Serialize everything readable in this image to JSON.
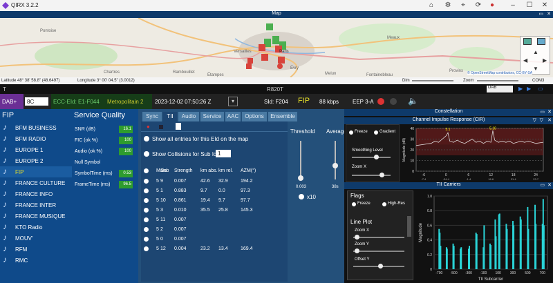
{
  "app": {
    "title": "QIRX 3.2.2"
  },
  "map": {
    "title": "Map",
    "latitude": "Latitude  48° 38' 58.8\" (48.6497)",
    "longitude": "Longitude 3° 00' 04.5\" (3.0012)",
    "dim": "Dim",
    "zoom": "Zoom",
    "com": "COM3",
    "attribution": "© OpenStreetMap contributors, CC-BY-SA",
    "places": [
      "Pontoise",
      "Paris",
      "Meaux",
      "Versailles",
      "Évry",
      "Melun",
      "Rambouillet",
      "Provins",
      "Chartres",
      "Étampes",
      "Fontainebleau"
    ]
  },
  "rx": {
    "left": "T",
    "center": "R820T",
    "mode": "DAB"
  },
  "info": {
    "band": "DAB+",
    "ch": "8C",
    "ecc": "ECC-EId: E1-F044",
    "ens": "Metropolitain 2",
    "datetime": "2023-12-02  07:50:26 Z",
    "sid": "SId: F204",
    "service": "FIP",
    "rate": "88 kbps",
    "eep": "EEP 3-A"
  },
  "fip": {
    "title": "FIP",
    "stations": [
      "BFM BUSINESS",
      "BFM RADIO",
      "EUROPE 1",
      "EUROPE 2",
      "FIP",
      "FRANCE CULTURE",
      "FRANCE INFO",
      "FRANCE INTER",
      "FRANCE MUSIQUE",
      "KTO Radio",
      "MOUV'",
      "RFM",
      "RMC"
    ]
  },
  "sq": {
    "title": "Service Quality",
    "rows": [
      {
        "label": "SNR (dB)",
        "value": "16.1",
        "color": "#2e9c2e"
      },
      {
        "label": "FIC (ok %)",
        "value": "100",
        "color": "#2e9c2e"
      },
      {
        "label": "Audio (ok %)",
        "value": "100",
        "color": "#2e9c2e"
      },
      {
        "label": "Null Symbol",
        "value": "",
        "color": ""
      },
      {
        "label": "SymbolTime (ms)",
        "value": "0.53",
        "color": "#2e9c2e"
      },
      {
        "label": "FrameTime (ms)",
        "value": "96.5",
        "color": "#2e9c2e"
      }
    ]
  },
  "tabs": {
    "items": [
      "Sync",
      "TII",
      "Audio",
      "Service",
      "AAC",
      "Options",
      "Ensemble"
    ],
    "active": 1
  },
  "tii": {
    "opt1": "Show all entries for this EId on the map",
    "opt2": "Show Collisions for Sub Id",
    "sub_sel": "1",
    "headers": [
      "Main",
      "Sub",
      "Strength",
      "km abs.",
      "km rel.",
      "AZM(°)"
    ],
    "rows": [
      [
        "5",
        "9",
        "0.007",
        "42.6",
        "32.9",
        "194.2"
      ],
      [
        "5",
        "1",
        "0.883",
        "9.7",
        "0.0",
        "97.3"
      ],
      [
        "5",
        "10",
        "0.861",
        "19.4",
        "9.7",
        "97.7"
      ],
      [
        "5",
        "3",
        "0.010",
        "35.5",
        "25.8",
        "145.3"
      ],
      [
        "5",
        "11",
        "0.007",
        "",
        "",
        ""
      ],
      [
        "5",
        "2",
        "0.007",
        "",
        "",
        ""
      ],
      [
        "5",
        "0",
        "0.007",
        "",
        "",
        ""
      ],
      [
        "5",
        "12",
        "0.004",
        "23.2",
        "13.4",
        "169.4"
      ]
    ],
    "threshold_label": "Threshold",
    "threshold_value": "0.003",
    "average_label": "Average",
    "average_value": "38s",
    "x10": "x10"
  },
  "constellation": {
    "title": "Constellation"
  },
  "cir": {
    "title": "Channel Impulse Response (CIR)",
    "freeze": "Freeze",
    "gradient": "Gradient",
    "smoothing": "Smoothing Level",
    "zoomx": "Zoom X",
    "xlabel": "Distance Difference (km)",
    "ylabel": "Magnitude (dB)",
    "xticks": [
      "-6",
      "0",
      "6",
      "12",
      "18",
      "24"
    ],
    "xsub": [
      "-7.4",
      "-34.4",
      "-1.4",
      "16.6",
      "31.4",
      "23.7"
    ],
    "yticks": [
      "40",
      "30",
      "20",
      "10",
      "0"
    ],
    "peaks": [
      "5.1",
      "5.10"
    ]
  },
  "tc": {
    "title": "TII Carriers",
    "flags": "Flags",
    "freeze": "Freeze",
    "highres": "High-Res",
    "lineplot": "Line Plot",
    "zoomx": "Zoom X",
    "zoomy": "Zoom Y",
    "offsety": "Offset Y",
    "xlabel": "TII Subcarrier",
    "ylabel": "Magnitude",
    "xticks": [
      "-700",
      "-500",
      "-300",
      "-100",
      "100",
      "300",
      "500",
      "700"
    ],
    "yticks": [
      "1.0",
      "0.8",
      "0.6",
      "0.4",
      "0.2",
      "0"
    ]
  },
  "chart_data": [
    {
      "type": "line",
      "title": "Channel Impulse Response (CIR)",
      "xlabel": "Distance Difference (km)",
      "ylabel": "Magnitude (dB)",
      "xlim": [
        -8,
        26
      ],
      "ylim": [
        0,
        40
      ],
      "series": [
        {
          "values": [
            [
              -8,
              24
            ],
            [
              -6,
              25
            ],
            [
              -4,
              26
            ],
            [
              -3,
              28
            ],
            [
              -2,
              27
            ],
            [
              -1,
              30
            ],
            [
              0,
              33
            ],
            [
              0.5,
              36
            ],
            [
              1,
              28
            ],
            [
              2,
              27
            ],
            [
              3,
              29
            ],
            [
              4,
              27
            ],
            [
              5,
              26
            ],
            [
              6,
              28
            ],
            [
              7,
              30
            ],
            [
              8,
              27
            ],
            [
              9,
              28
            ],
            [
              10,
              26
            ],
            [
              11,
              28
            ],
            [
              12,
              27
            ],
            [
              12.5,
              38
            ],
            [
              13,
              29
            ],
            [
              14,
              27
            ],
            [
              15,
              28
            ],
            [
              16,
              27
            ],
            [
              17,
              28
            ],
            [
              18,
              26
            ],
            [
              19,
              27
            ],
            [
              20,
              28
            ],
            [
              21,
              27
            ],
            [
              22,
              28
            ],
            [
              23,
              27
            ],
            [
              24,
              26
            ],
            [
              26,
              27
            ]
          ]
        }
      ]
    },
    {
      "type": "bar",
      "title": "TII Carriers",
      "xlabel": "TII Subcarrier",
      "ylabel": "Magnitude",
      "xlim": [
        -768,
        768
      ],
      "ylim": [
        0,
        1.0
      ],
      "values": [
        [
          -700,
          0.55
        ],
        [
          -690,
          0.5
        ],
        [
          -680,
          0.32
        ],
        [
          -600,
          0.3
        ],
        [
          -592,
          0.28
        ],
        [
          -510,
          0.35
        ],
        [
          -500,
          0.32
        ],
        [
          -412,
          0.28
        ],
        [
          -400,
          0.3
        ],
        [
          -300,
          0.28
        ],
        [
          -290,
          0.32
        ],
        [
          -200,
          0.5
        ],
        [
          -190,
          0.48
        ],
        [
          -100,
          0.3
        ],
        [
          -90,
          0.6
        ],
        [
          -10,
          0.35
        ],
        [
          0,
          0.33
        ],
        [
          60,
          0.68
        ],
        [
          70,
          0.45
        ],
        [
          110,
          0.75
        ],
        [
          120,
          0.76
        ],
        [
          210,
          0.62
        ],
        [
          220,
          0.55
        ],
        [
          300,
          0.66
        ],
        [
          310,
          0.6
        ],
        [
          400,
          0.72
        ],
        [
          410,
          0.68
        ],
        [
          500,
          0.85
        ],
        [
          510,
          0.55
        ],
        [
          600,
          0.88
        ],
        [
          610,
          0.62
        ],
        [
          700,
          0.62
        ],
        [
          710,
          0.96
        ],
        [
          720,
          0.6
        ]
      ]
    }
  ]
}
